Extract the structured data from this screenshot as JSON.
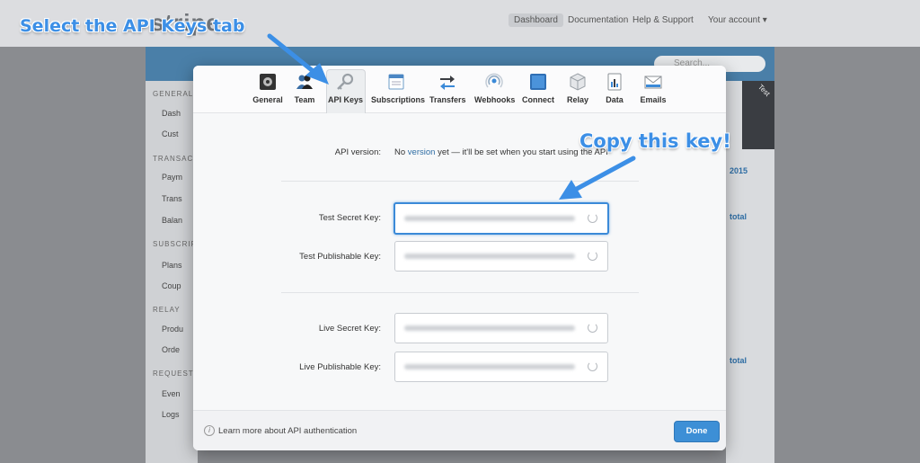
{
  "background": {
    "logo": "stripe",
    "nav": [
      "Dashboard",
      "Documentation",
      "Help & Support",
      "Your account ▾"
    ],
    "search_placeholder": "Search...",
    "env_badge": "Test",
    "sidebar_sections": [
      "GENERAL",
      "TRANSACTIONS",
      "SUBSCRIPTIONS",
      "RELAY",
      "REQUESTS"
    ],
    "sidebar_items": [
      "Dash",
      "Cust",
      "Paym",
      "Trans",
      "Balan",
      "Plans",
      "Coup",
      "Produ",
      "Orde",
      "Even",
      "Logs"
    ],
    "right_fragments": [
      "2015",
      "total",
      "total"
    ]
  },
  "tabs": [
    {
      "label": "General",
      "icon": "general-icon"
    },
    {
      "label": "Team",
      "icon": "team-icon"
    },
    {
      "label": "API Keys",
      "icon": "key-icon",
      "active": true
    },
    {
      "label": "Subscriptions",
      "icon": "subscriptions-icon"
    },
    {
      "label": "Transfers",
      "icon": "transfers-icon"
    },
    {
      "label": "Webhooks",
      "icon": "webhooks-icon"
    },
    {
      "label": "Connect",
      "icon": "connect-icon"
    },
    {
      "label": "Relay",
      "icon": "relay-icon"
    },
    {
      "label": "Data",
      "icon": "data-icon"
    },
    {
      "label": "Emails",
      "icon": "emails-icon"
    }
  ],
  "api_version": {
    "label": "API version:",
    "prefix": "No",
    "link": "version",
    "suffix": "yet — it'll be set when you start using the API"
  },
  "keys": {
    "test_secret_label": "Test Secret Key:",
    "test_publishable_label": "Test Publishable Key:",
    "live_secret_label": "Live Secret Key:",
    "live_publishable_label": "Live Publishable Key:"
  },
  "footer": {
    "info_text": "Learn more about API authentication",
    "done_label": "Done"
  },
  "annotations": {
    "select_tab": "Select the API Keys tab",
    "copy_key": "Copy this key!"
  },
  "colors": {
    "accent": "#3d8fd6",
    "callout": "#3c8fe6"
  }
}
